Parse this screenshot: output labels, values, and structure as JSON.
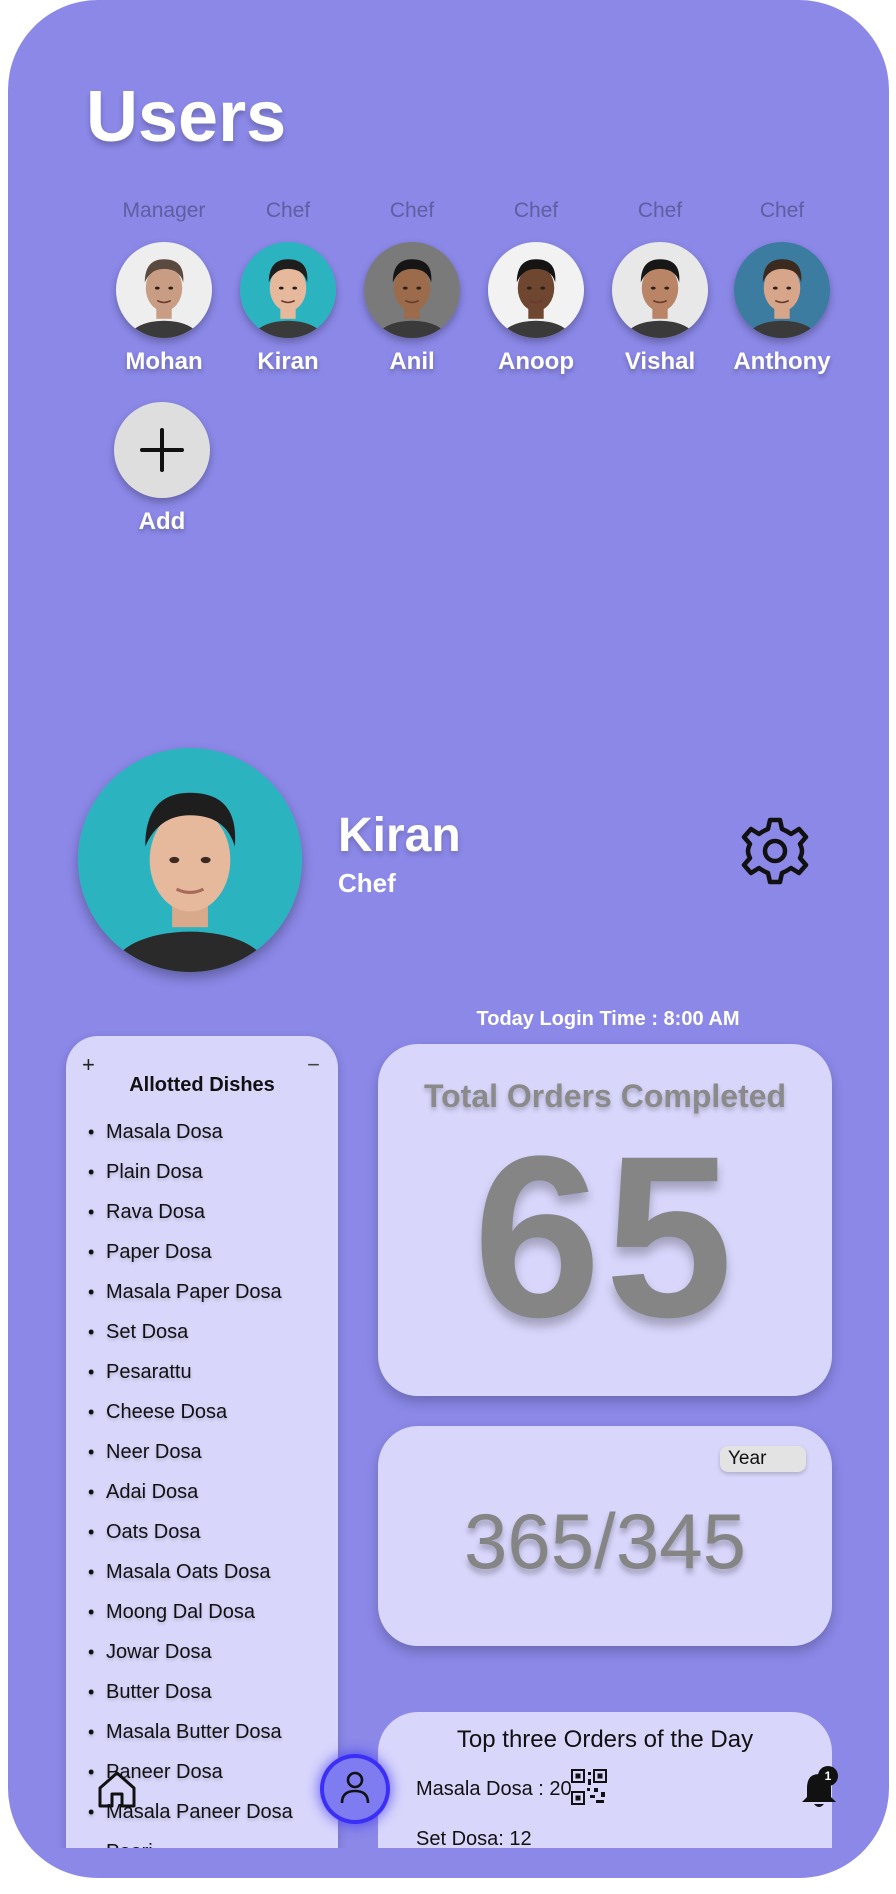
{
  "header": {
    "title": "Users"
  },
  "users": [
    {
      "role": "Manager",
      "name": "Mohan",
      "bg": "#eeeeee",
      "skin": "#c99d83",
      "hair": "#5a4a40"
    },
    {
      "role": "Chef",
      "name": "Kiran",
      "bg": "#2bb3c0",
      "skin": "#e6b89c",
      "hair": "#1e1e1e"
    },
    {
      "role": "Chef",
      "name": "Anil",
      "bg": "#7a7a7a",
      "skin": "#9b6b4b",
      "hair": "#151515"
    },
    {
      "role": "Chef",
      "name": "Anoop",
      "bg": "#f2f2f2",
      "skin": "#6f4630",
      "hair": "#141414"
    },
    {
      "role": "Chef",
      "name": "Vishal",
      "bg": "#e8e8e8",
      "skin": "#b98566",
      "hair": "#171717"
    },
    {
      "role": "Chef",
      "name": "Anthony",
      "bg": "#3b7ca0",
      "skin": "#d6a58a",
      "hair": "#3a2a20"
    }
  ],
  "add_user": {
    "label": "Add"
  },
  "profile": {
    "name": "Kiran",
    "role": "Chef"
  },
  "login_time": "Today Login Time : 8:00 AM",
  "dishes": {
    "title": "Allotted Dishes",
    "add_symbol": "+",
    "remove_symbol": "−",
    "items": [
      "Masala Dosa",
      "Plain Dosa",
      "Rava Dosa",
      "Paper Dosa",
      "Masala Paper Dosa",
      "Set Dosa",
      "Pesarattu",
      "Cheese Dosa",
      "Neer Dosa",
      "Adai Dosa",
      "Oats Dosa",
      "Masala Oats Dosa",
      "Moong Dal Dosa",
      "Jowar Dosa",
      "Butter Dosa",
      "Masala Butter Dosa",
      "Paneer Dosa",
      "Masala Paneer Dosa",
      "Poori"
    ]
  },
  "orders": {
    "title": "Total Orders Completed",
    "value": "65"
  },
  "yearly": {
    "period": "Year",
    "value": "365/345"
  },
  "top_orders": {
    "title": "Top three Orders of the Day",
    "items": [
      "Masala Dosa : 20",
      "Set Dosa: 12"
    ]
  },
  "nav": {
    "notification_count": "1"
  },
  "colors": {
    "background": "#8b88e8",
    "card": "#d8d6fb",
    "active_nav": "#3b2ff7"
  }
}
